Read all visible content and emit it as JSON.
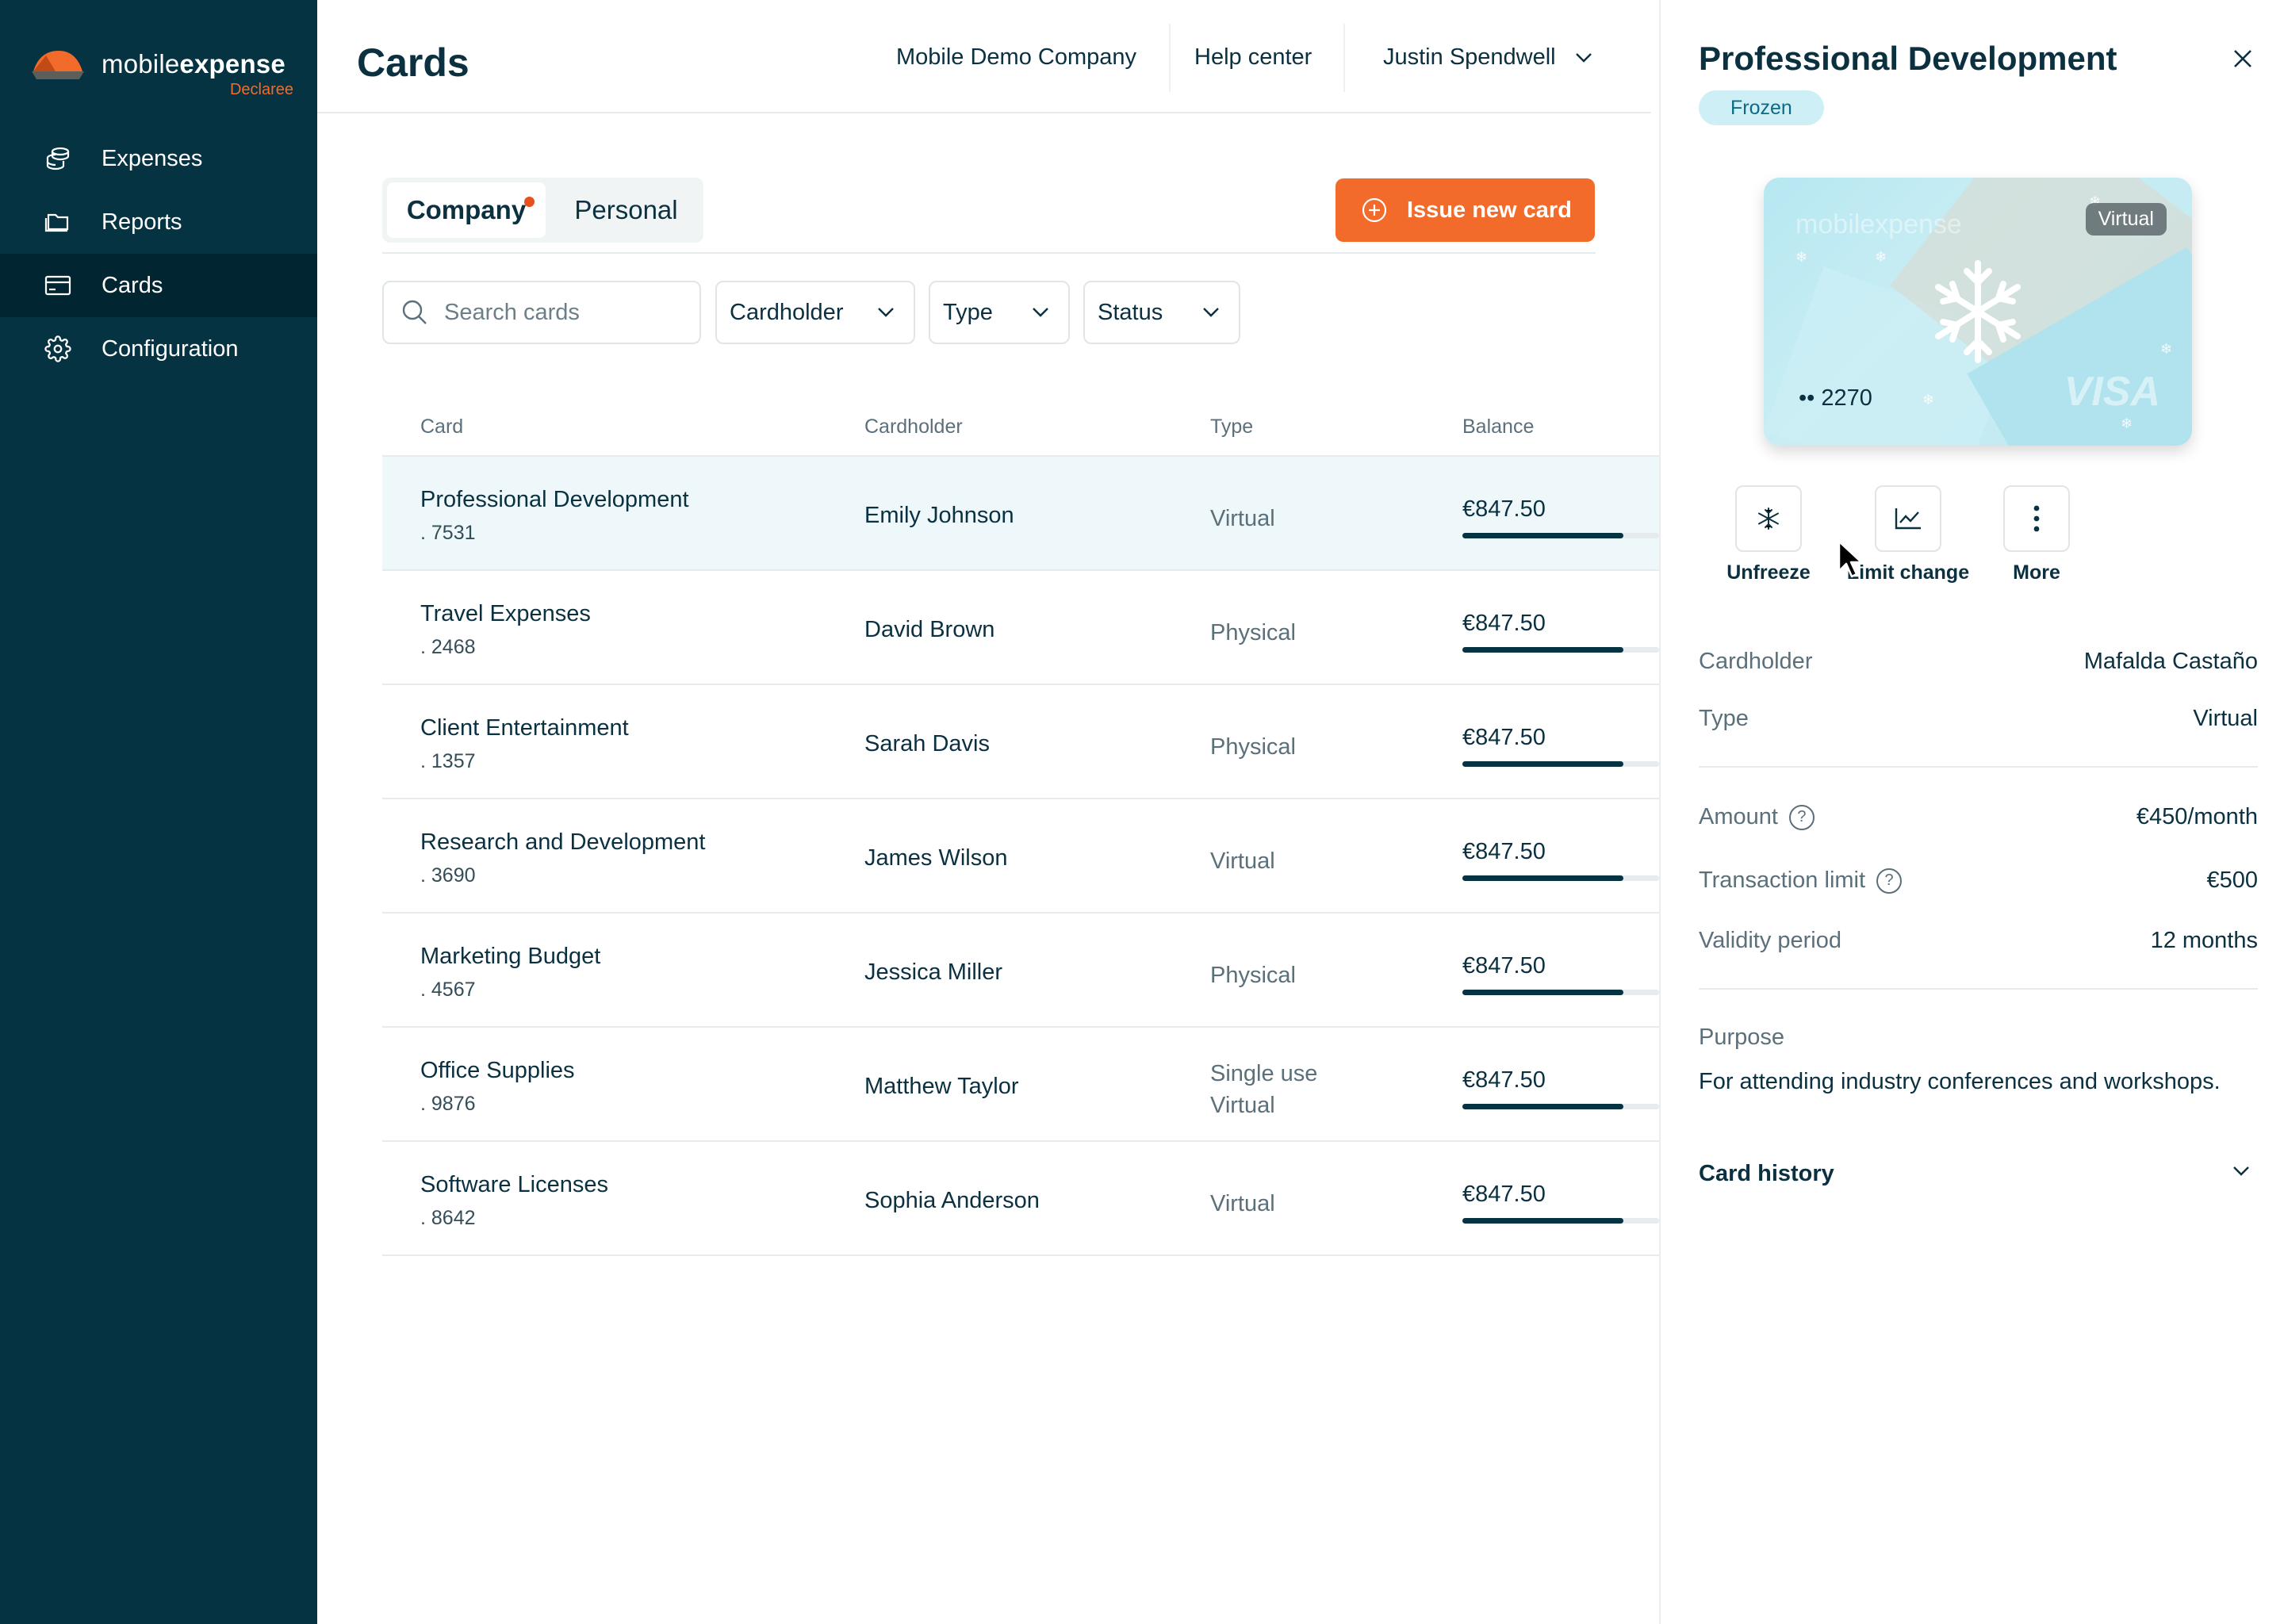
{
  "app": {
    "logo_main": "mobile",
    "logo_bold": "expense",
    "logo_sub": "Declaree"
  },
  "sidebar": {
    "items": [
      {
        "label": "Expenses",
        "icon": "coins-icon"
      },
      {
        "label": "Reports",
        "icon": "folder-icon"
      },
      {
        "label": "Cards",
        "icon": "card-icon",
        "active": true
      },
      {
        "label": "Configuration",
        "icon": "gear-icon"
      }
    ]
  },
  "header": {
    "title": "Cards",
    "company": "Mobile Demo Company",
    "help": "Help center",
    "user": "Justin Spendwell"
  },
  "tabs": {
    "company": "Company",
    "personal": "Personal",
    "active": "Company"
  },
  "issue_button": "Issue new card",
  "search": {
    "placeholder": "Search cards",
    "value": ""
  },
  "filters": {
    "cardholder": "Cardholder",
    "type": "Type",
    "status": "Status"
  },
  "table": {
    "headers": {
      "card": "Card",
      "cardholder": "Cardholder",
      "type": "Type",
      "balance": "Balance"
    },
    "rows": [
      {
        "name": "Professional Development",
        "number": ". 7531",
        "holder": "Emily Johnson",
        "type": "Virtual",
        "type2": "",
        "balance": "€847.50",
        "progress": 0.82,
        "selected": true
      },
      {
        "name": "Travel Expenses",
        "number": ". 2468",
        "holder": "David Brown",
        "type": "Physical",
        "type2": "",
        "balance": "€847.50",
        "progress": 0.82
      },
      {
        "name": "Client Entertainment",
        "number": ". 1357",
        "holder": "Sarah Davis",
        "type": "Physical",
        "type2": "",
        "balance": "€847.50",
        "progress": 0.82
      },
      {
        "name": "Research and Development",
        "number": ". 3690",
        "holder": "James Wilson",
        "type": "Virtual",
        "type2": "",
        "balance": "€847.50",
        "progress": 0.82
      },
      {
        "name": "Marketing Budget",
        "number": ". 4567",
        "holder": "Jessica Miller",
        "type": "Physical",
        "type2": "",
        "balance": "€847.50",
        "progress": 0.82
      },
      {
        "name": "Office Supplies",
        "number": ". 9876",
        "holder": "Matthew Taylor",
        "type": "Single use",
        "type2": "Virtual",
        "balance": "€847.50",
        "progress": 0.82
      },
      {
        "name": "Software Licenses",
        "number": ". 8642",
        "holder": "Sophia Anderson",
        "type": "Virtual",
        "type2": "",
        "balance": "€847.50",
        "progress": 0.82
      }
    ]
  },
  "panel": {
    "title": "Professional Development",
    "status": "Frozen",
    "card": {
      "badge": "Virtual",
      "number": "•• 2270",
      "watermark": "mobilexpense",
      "brand": "VISA"
    },
    "actions": {
      "unfreeze": "Unfreeze",
      "limit": "Limit change",
      "more": "More"
    },
    "details": {
      "cardholder_label": "Cardholder",
      "cardholder": "Mafalda Castaño",
      "type_label": "Type",
      "type": "Virtual",
      "amount_label": "Amount",
      "amount": "€450/month",
      "tx_label": "Transaction limit",
      "tx": "€500",
      "validity_label": "Validity period",
      "validity": "12 months",
      "help_glyph": "?"
    },
    "purpose_label": "Purpose",
    "purpose": "For attending industry conferences and workshops.",
    "history": "Card history"
  },
  "colors": {
    "sidebar": "#053341",
    "accent": "#f26b2b",
    "selected_row": "#eef8fa",
    "badge_bg": "#cfeff6"
  }
}
